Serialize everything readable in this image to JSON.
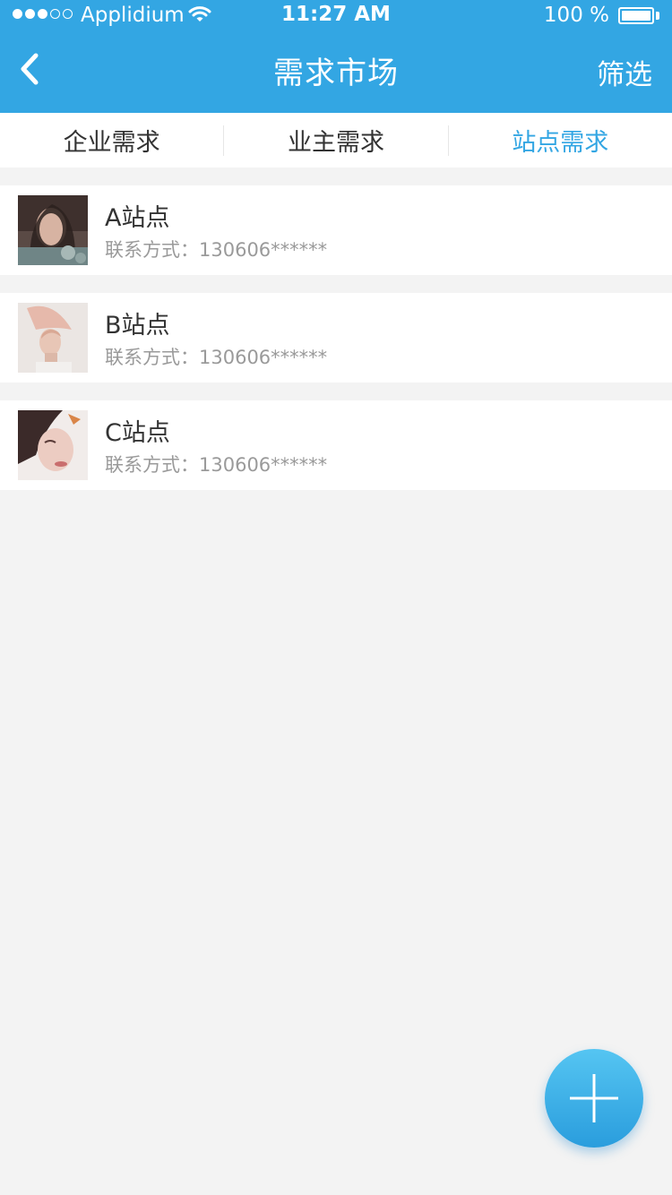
{
  "status_bar": {
    "carrier": "Applidium",
    "time": "11:27 AM",
    "battery": "100 %"
  },
  "nav": {
    "title": "需求市场",
    "filter_label": "筛选"
  },
  "tabs": [
    {
      "label": "企业需求",
      "active": false
    },
    {
      "label": "业主需求",
      "active": false
    },
    {
      "label": "站点需求",
      "active": true
    }
  ],
  "items": [
    {
      "name": "A站点",
      "contact": "联系方式：130606******"
    },
    {
      "name": "B站点",
      "contact": "联系方式：130606******"
    },
    {
      "name": "C站点",
      "contact": "联系方式：130606******"
    }
  ],
  "colors": {
    "accent": "#33a6e3",
    "background": "#f3f3f3",
    "secondary_text": "#9a9a9a"
  }
}
